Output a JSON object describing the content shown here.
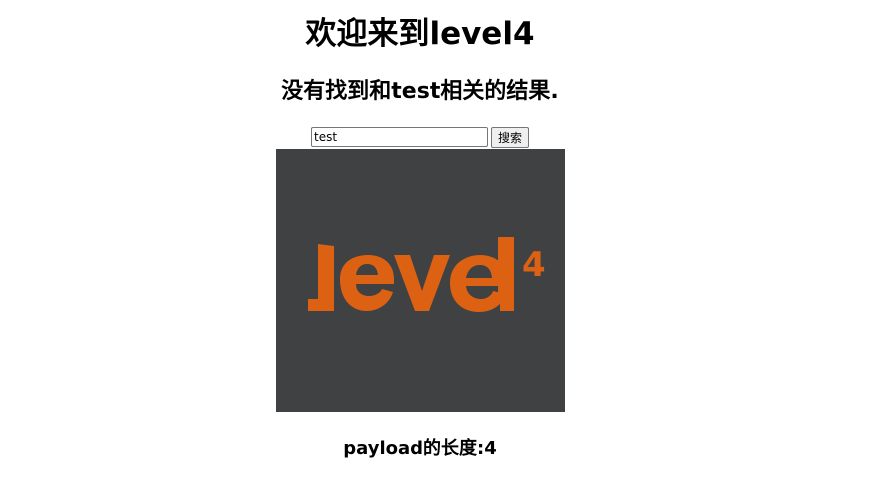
{
  "header": {
    "title": "欢迎来到level4",
    "message": "没有找到和test相关的结果."
  },
  "search": {
    "value": "test",
    "button_label": "搜索"
  },
  "logo": {
    "text": "level",
    "superscript": "4",
    "background_color": "#404142",
    "text_color": "#dd6112"
  },
  "footer": {
    "payload_length": "payload的长度:4"
  }
}
